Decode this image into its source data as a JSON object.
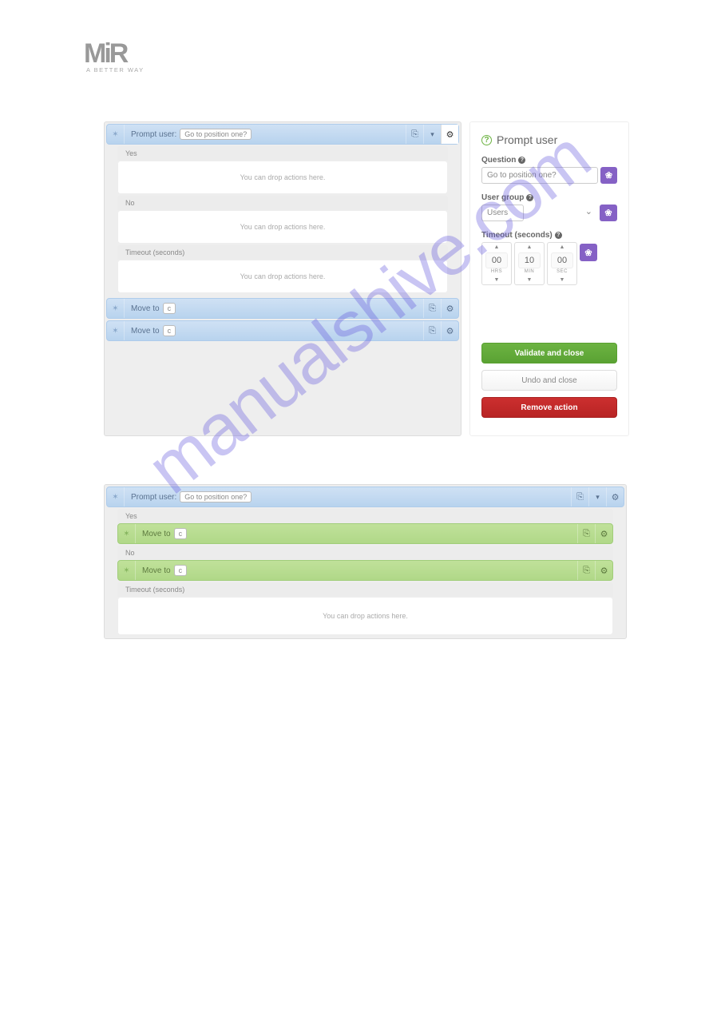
{
  "logo": {
    "text": "MiR",
    "tagline": "A BETTER WAY"
  },
  "watermark": "manualshive.com",
  "drop_text": "You can drop actions here.",
  "sections": {
    "yes": "Yes",
    "no": "No",
    "timeout": "Timeout (seconds)"
  },
  "top_editor": {
    "prompt_bar": {
      "label": "Prompt user:",
      "tag": "Go to position one?"
    },
    "move_bars": [
      {
        "label": "Move to",
        "tag": "c"
      },
      {
        "label": "Move to",
        "tag": "c"
      }
    ]
  },
  "side_panel": {
    "title": "Prompt user",
    "question": {
      "label": "Question",
      "value": "Go to position one?"
    },
    "usergroup": {
      "label": "User group",
      "value": "Users"
    },
    "timeout": {
      "label": "Timeout (seconds)",
      "hrs": {
        "val": "00",
        "unit": "HRS"
      },
      "min": {
        "val": "10",
        "unit": "MIN"
      },
      "sec": {
        "val": "00",
        "unit": "SEC"
      }
    },
    "buttons": {
      "validate": "Validate and close",
      "undo": "Undo and close",
      "remove": "Remove action"
    }
  },
  "bottom_editor": {
    "prompt_bar": {
      "label": "Prompt user:",
      "tag": "Go to position one?"
    },
    "yes_move": {
      "label": "Move to",
      "tag": "c"
    },
    "no_move": {
      "label": "Move to",
      "tag": "c"
    }
  }
}
